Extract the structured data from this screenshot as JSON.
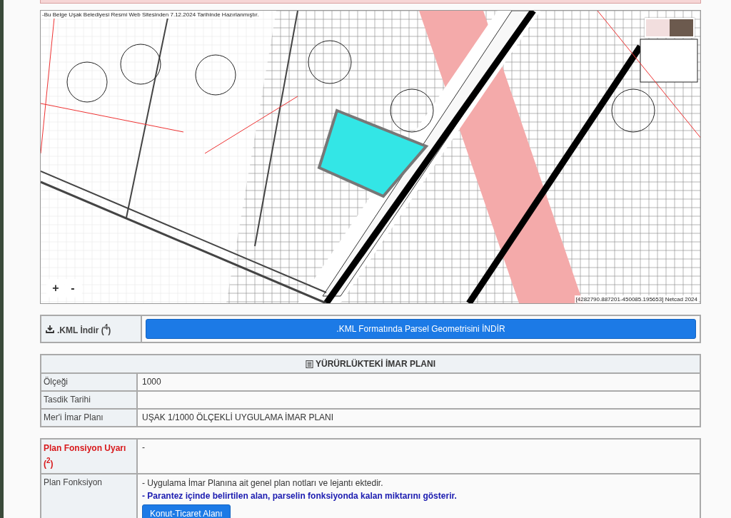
{
  "map": {
    "caption": "-Bu Belge Uşak Belediyesi Resmi Web Sitesinden 7.12.2024 Tarihinde Hazırlanmıştır.",
    "attribution": "[4282790.887201-450085.195653] Netcad 2024",
    "zoom_in": "+",
    "zoom_out": "-"
  },
  "kml": {
    "label": ".KML İndir ($^{4}$)",
    "button": ".KML Formatında Parsel Geometrisini İNDİR"
  },
  "plan": {
    "title": "YÜRÜRLÜKTEKİ İMAR PLANI",
    "rows": [
      {
        "label": "Ölçeği",
        "value": "1000"
      },
      {
        "label": "Tasdik Tarihi"
      },
      {
        "label": "Mer'i İmar Planı",
        "value": "UŞAK 1/1000 ÖLÇEKLİ UYGULAMA İMAR PLANI"
      }
    ]
  },
  "function": {
    "rows": [
      {
        "kind": "warning",
        "label": "Plan Fonsiyon Uyarı ($^{2}$)",
        "value": "-"
      },
      {
        "kind": "plain",
        "label": "Plan Fonksiyon",
        "lines": [
          {
            "text": "- Uygulama İmar Planına ait genel plan notları ve lejantı ektedir.",
            "bold": false
          },
          {
            "text": "- Parantez içinde belirtilen alan, parselin fonksiyonda kalan miktarını gösterir.",
            "bold": true
          }
        ],
        "button": "Konut-Ticaret Alanı"
      }
    ]
  }
}
